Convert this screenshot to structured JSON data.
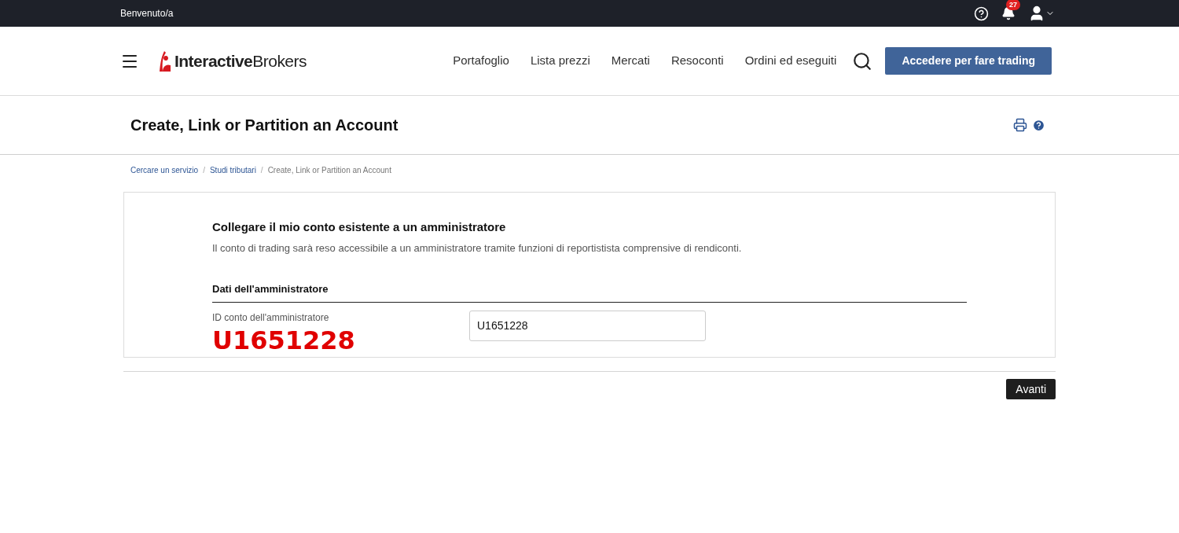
{
  "top_bar": {
    "welcome": "Benvenuto/a",
    "notification_count": "27"
  },
  "header": {
    "logo": "**Interactive**Brokers",
    "nav": [
      "Portafoglio",
      "Lista prezzi",
      "Mercati",
      "Resoconti",
      "Ordini ed eseguiti"
    ],
    "trade_button": "Accedere per fare trading"
  },
  "page": {
    "title": "Create, Link or Partition an Account"
  },
  "breadcrumbs": [
    {
      "label": "Cercare un servizio",
      "kind": "link",
      "separator": "/"
    },
    {
      "label": "Studi tributari",
      "kind": "link",
      "separator": "/"
    },
    {
      "label": "Create, Link or Partition an Account",
      "kind": "current"
    }
  ],
  "form": {
    "heading": "Collegare il mio conto esistente a un amministratore",
    "description": "Il conto di trading sarà reso accessibile a un amministratore tramite funzioni di reportistista comprensive di rendiconti.",
    "section": "Dati dell'amministratore",
    "field_label": "ID conto dell'amministratore",
    "annotation": "U1651228",
    "field_value": "U1651228"
  },
  "next_button": "Avanti"
}
